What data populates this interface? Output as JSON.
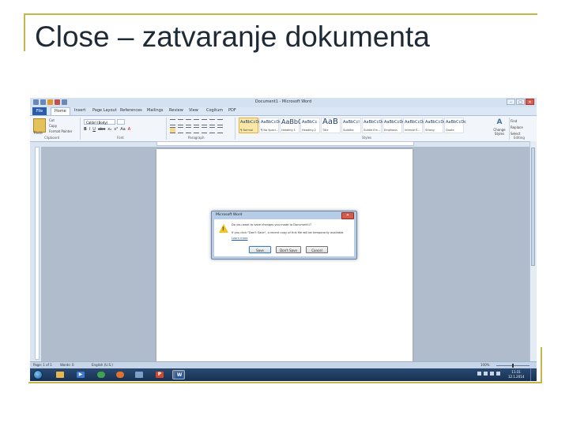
{
  "slide": {
    "title": "Close – zatvaranje dokumenta",
    "frame_color": "#c5b64a"
  },
  "word": {
    "window_title": "Document1 - Microsoft Word",
    "ribbon_tabs": [
      "File",
      "Home",
      "Insert",
      "Page Layout",
      "References",
      "Mailings",
      "Review",
      "View",
      "Cogitum",
      "PDF"
    ],
    "clipboard": {
      "paste_label": "Paste",
      "cut_label": "Cut",
      "copy_label": "Copy",
      "format_painter_label": "Format Painter",
      "group_label": "Clipboard"
    },
    "font": {
      "name_value": "Calibri (Body)",
      "size_value": "11",
      "format_buttons": [
        "B",
        "I",
        "U",
        "abe",
        "x₂",
        "x²",
        "Aa",
        "A"
      ],
      "group_label": "Font"
    },
    "paragraph": {
      "group_label": "Paragraph"
    },
    "styles": {
      "items": [
        {
          "preview": "AaBbCcDc",
          "name": "¶ Normal"
        },
        {
          "preview": "AaBbCcDc",
          "name": "¶ No Spaci..."
        },
        {
          "preview": "AaBbCc",
          "name": "Heading 1"
        },
        {
          "preview": "AaBbCc",
          "name": "Heading 2"
        },
        {
          "preview": "AaB",
          "name": "Title"
        },
        {
          "preview": "AaBbCcI",
          "name": "Subtitle"
        },
        {
          "preview": "AaBbCcDc",
          "name": "Subtle Em..."
        },
        {
          "preview": "AaBbCcDc",
          "name": "Emphasis"
        },
        {
          "preview": "AaBbCcDc",
          "name": "Intense E..."
        },
        {
          "preview": "AaBbCcDc",
          "name": "Strong"
        },
        {
          "preview": "AaBbCcDc",
          "name": "Quote"
        }
      ],
      "group_label": "Styles",
      "change_styles_label": "Change Styles"
    },
    "editing": {
      "find_label": "Find",
      "replace_label": "Replace",
      "select_label": "Select",
      "group_label": "Editing"
    },
    "dialog": {
      "title": "Microsoft Word",
      "close_glyph": "✕",
      "message": "Do you want to save changes you made to Document1?",
      "detail": "If you click \"Don't Save\", a recent copy of this file will be temporarily available.",
      "link": "Learn more",
      "save_label": "Save",
      "dont_save_label": "Don't Save",
      "cancel_label": "Cancel"
    },
    "status": {
      "page": "Page: 1 of 1",
      "words": "Words: 0",
      "language": "English (U.S.)",
      "zoom": "100%"
    }
  },
  "taskbar": {
    "time": "11:31",
    "date": "12.1.2014",
    "apps": [
      {
        "icon": "windows-explorer-icon",
        "color": "#e6b84a"
      },
      {
        "icon": "media-player-icon",
        "color": "#3b7bd4"
      },
      {
        "icon": "chrome-icon",
        "color": "#3fa34d"
      },
      {
        "icon": "firefox-icon",
        "color": "#e0702a"
      },
      {
        "icon": "paint-icon",
        "color": "#7aa0c8"
      },
      {
        "icon": "powerpoint-icon",
        "color": "#d24726"
      },
      {
        "icon": "word-icon",
        "color": "#2b579a"
      }
    ]
  }
}
